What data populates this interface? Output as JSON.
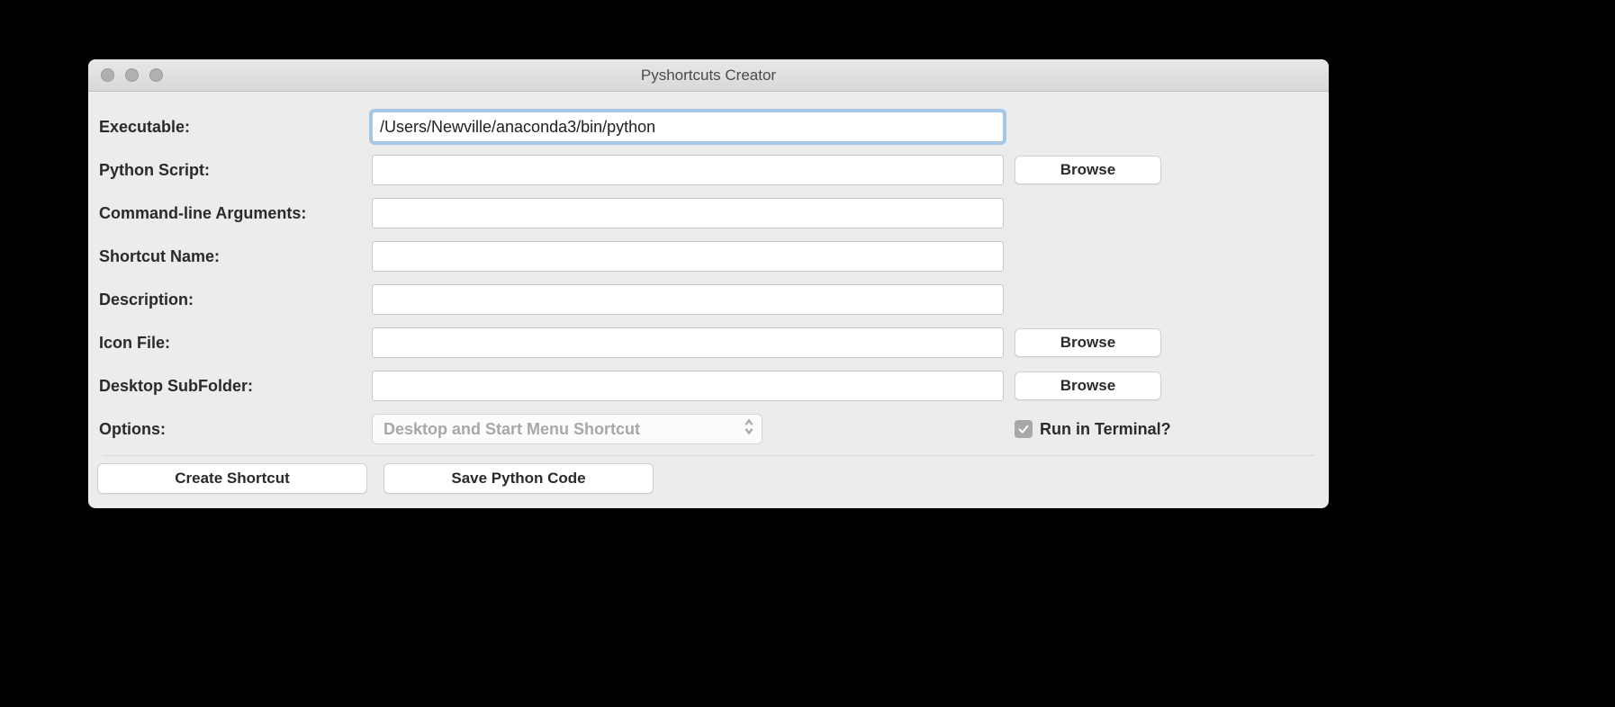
{
  "window": {
    "title": "Pyshortcuts Creator"
  },
  "labels": {
    "executable": "Executable:",
    "python_script": "Python Script:",
    "cmd_args": "Command-line Arguments:",
    "shortcut_name": "Shortcut Name:",
    "description": "Description:",
    "icon_file": "Icon File:",
    "desktop_subfolder": "Desktop SubFolder:",
    "options": "Options:"
  },
  "fields": {
    "executable": "/Users/Newville/anaconda3/bin/python",
    "python_script": "",
    "cmd_args": "",
    "shortcut_name": "",
    "description": "",
    "icon_file": "",
    "desktop_subfolder": ""
  },
  "buttons": {
    "browse": "Browse",
    "create_shortcut": "Create Shortcut",
    "save_python_code": "Save Python Code"
  },
  "options": {
    "select_value": "Desktop and Start Menu Shortcut",
    "run_in_terminal_label": "Run in Terminal?",
    "run_in_terminal_checked": true
  }
}
